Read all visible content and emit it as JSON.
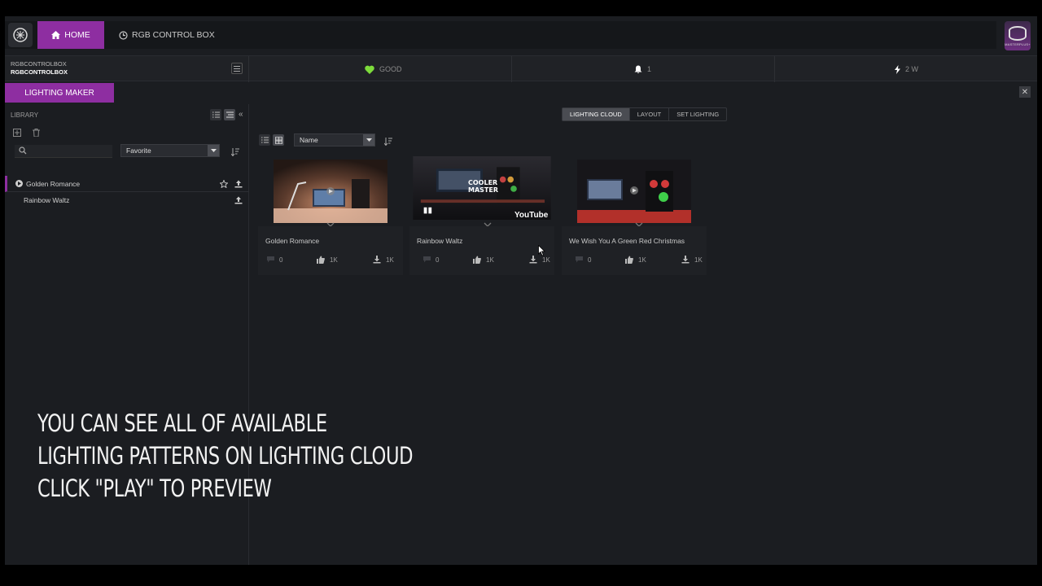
{
  "nav": {
    "home_label": "HOME",
    "rgb_label": "RGB CONTROL BOX"
  },
  "status": {
    "device_line1": "RGBCONTROLBOX",
    "device_line2": "RGBCONTROLBOX",
    "health": "GOOD",
    "notifications": "1",
    "power": "2 W"
  },
  "lighting_maker": {
    "tab_label": "LIGHTING MAKER"
  },
  "library": {
    "title": "LIBRARY",
    "filter_value": "Favorite",
    "items": [
      {
        "name": "Golden Romance"
      },
      {
        "name": "Rainbow Waltz"
      }
    ]
  },
  "main": {
    "tabs": [
      "LIGHTING CLOUD",
      "LAYOUT",
      "SET LIGHTING"
    ],
    "sort_value": "Name",
    "cards": [
      {
        "title": "Golden Romance",
        "comments": "0",
        "likes": "1K",
        "downloads": "1K"
      },
      {
        "title": "Rainbow Waltz",
        "comments": "0",
        "likes": "1K",
        "downloads": "1K",
        "badge": "YouTube",
        "logo_text": "COOLER MASTER"
      },
      {
        "title": "We Wish You A Green Red Christmas",
        "comments": "0",
        "likes": "1K",
        "downloads": "1K"
      }
    ]
  },
  "overlay": {
    "line1": "YOU CAN SEE ALL OF AVAILABLE",
    "line2": "LIGHTING PATTERNS ON LIGHTING CLOUD",
    "line3": "CLICK \"PLAY\" TO PREVIEW"
  },
  "colors": {
    "accent": "#8e2ea1",
    "health_green": "#7ddc3b"
  }
}
